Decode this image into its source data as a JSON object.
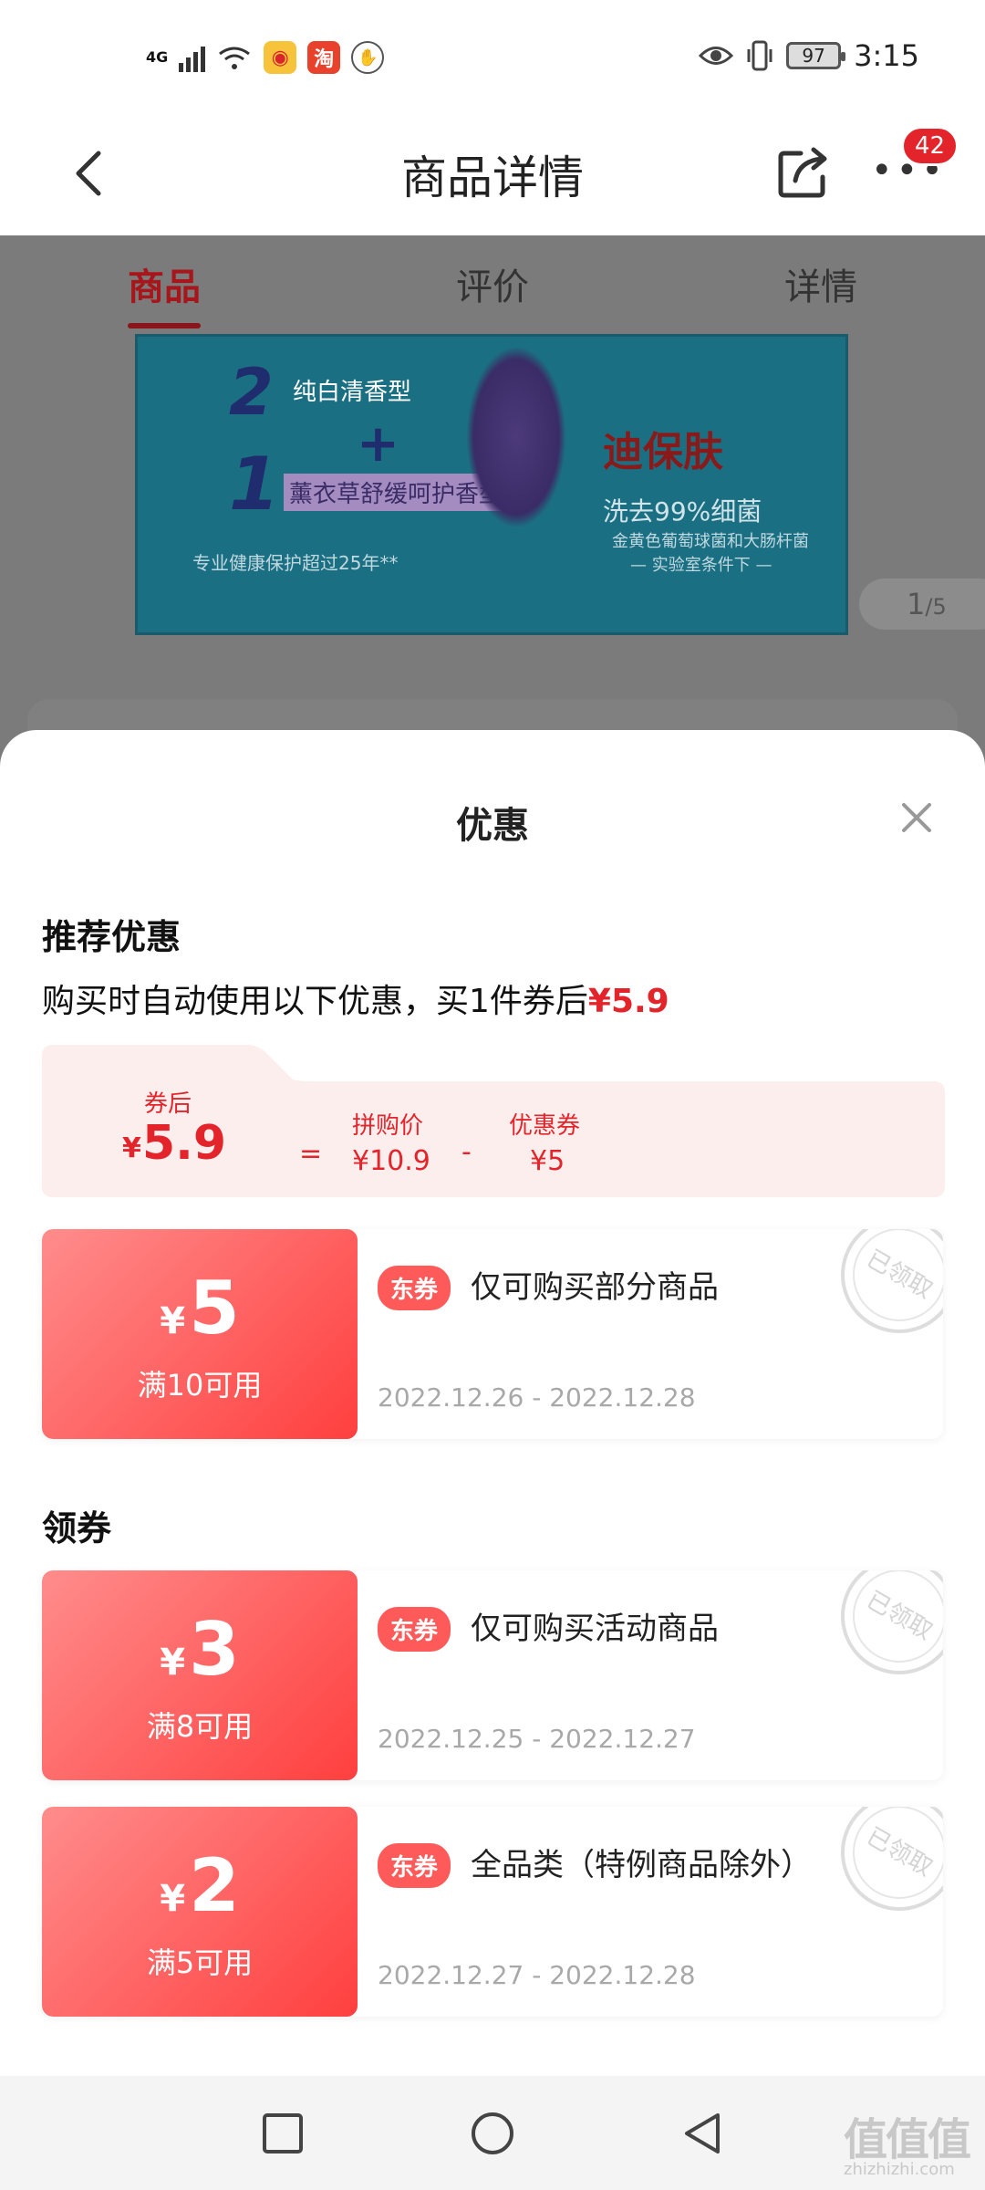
{
  "status_bar": {
    "network": "4G",
    "battery": "97",
    "time": "3:15",
    "app_icons": [
      "weibo-icon",
      "taobao-icon",
      "app-icon"
    ]
  },
  "header": {
    "title": "商品详情",
    "badge_count": "42"
  },
  "tabs": [
    "商品",
    "评价",
    "详情"
  ],
  "banner": {
    "line2": "纯白清香型",
    "line1": "薰衣草舒缓呵护香型",
    "num_a": "2",
    "num_b": "1",
    "brand": "迪保肤",
    "claim": "洗去99%细菌",
    "sub1": "金黄色葡萄球菌和大肠杆菌",
    "sub2": "— 实验室条件下 —",
    "footnote": "专业健康保护超过25年**",
    "pager_current": "1",
    "pager_total": "/5"
  },
  "sheet": {
    "title": "优惠",
    "recommend_title": "推荐优惠",
    "auto_text": "购买时自动使用以下优惠，买1件券后",
    "auto_price": "¥5.9",
    "summary": {
      "after_label": "券后",
      "after_yen": "¥",
      "after_value": "5.9",
      "equals": "=",
      "group_label": "拼购价",
      "group_value": "¥10.9",
      "minus": "-",
      "coupon_label": "优惠券",
      "coupon_value": "¥5"
    },
    "claim_title": "领券",
    "coupons": [
      {
        "yen": "¥",
        "amount": "5",
        "condition": "满10可用",
        "tag": "东券",
        "desc": "仅可购买部分商品",
        "date": "2022.12.26 - 2022.12.28",
        "stamp": "已领取"
      },
      {
        "yen": "¥",
        "amount": "3",
        "condition": "满8可用",
        "tag": "东券",
        "desc": "仅可购买活动商品",
        "date": "2022.12.25 - 2022.12.27",
        "stamp": "已领取"
      },
      {
        "yen": "¥",
        "amount": "2",
        "condition": "满5可用",
        "tag": "东券",
        "desc": "全品类（特例商品除外）",
        "date": "2022.12.27 - 2022.12.28",
        "stamp": "已领取"
      }
    ]
  },
  "watermark": {
    "logo": "值值值",
    "domain": "zhizhizhi.com"
  },
  "colors": {
    "accent_red": "#e3242b",
    "coupon_gradient_start": "#ff8c8c",
    "coupon_gradient_end": "#ff3f3f",
    "summary_bg": "#fdeeee"
  }
}
